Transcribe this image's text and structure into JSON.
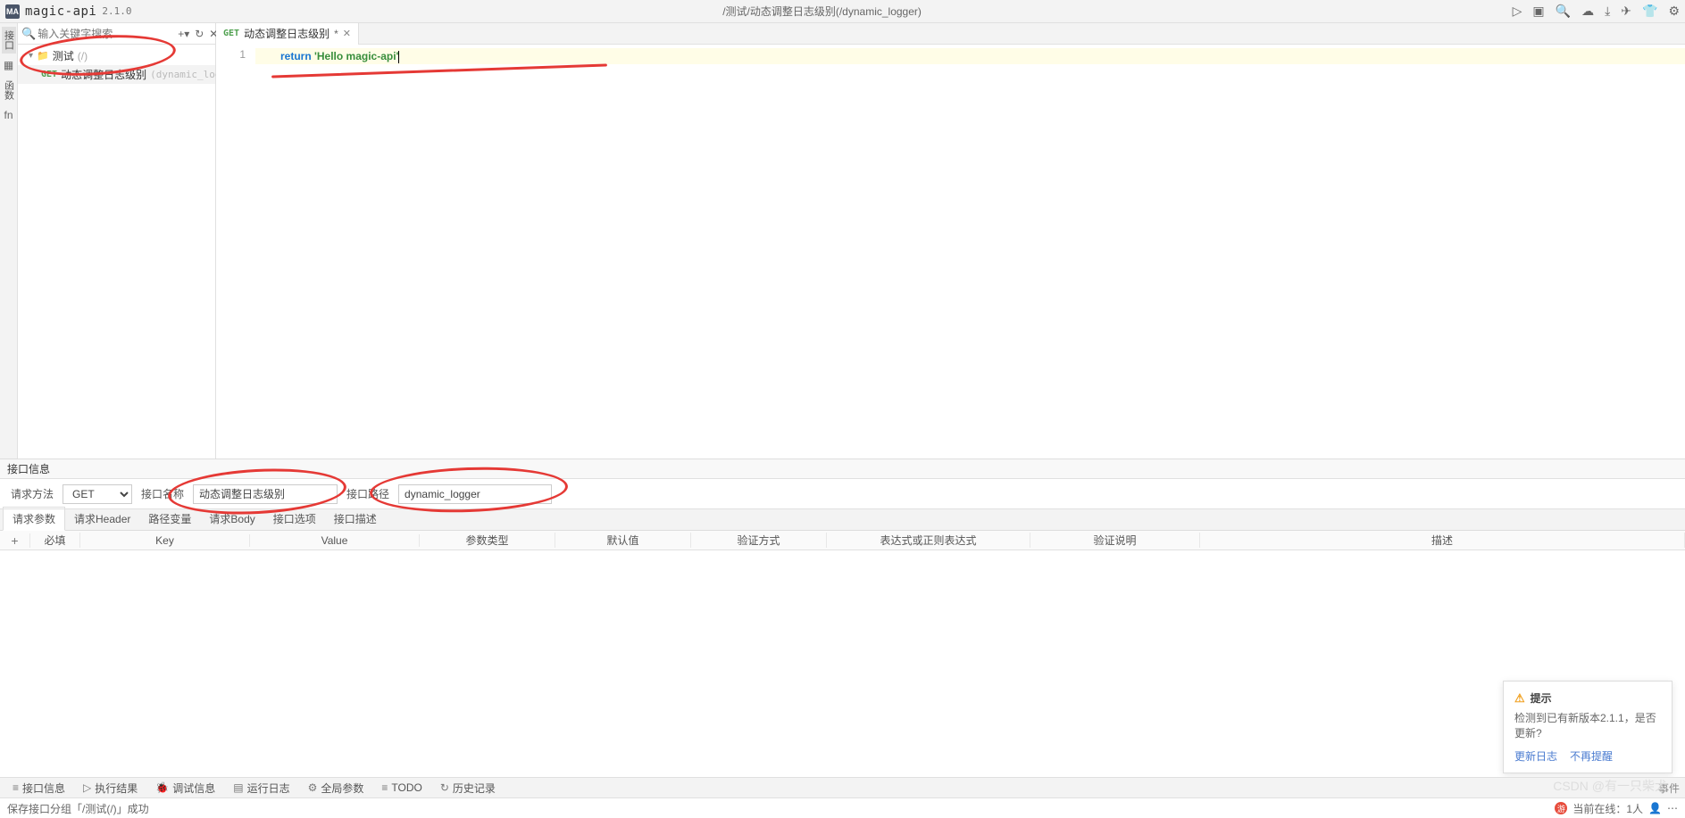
{
  "header": {
    "logo": "MA",
    "app_name": "magic-api",
    "version": "2.1.0",
    "path_display": "/测试/动态调整日志级别(/dynamic_logger)"
  },
  "left_rail": {
    "items": [
      "接口",
      "函数"
    ],
    "icons": [
      "▦",
      "fn"
    ]
  },
  "sidebar": {
    "search_placeholder": "输入关键字搜索",
    "tree": {
      "folder_name": "测试",
      "folder_path": "(/)",
      "child_method": "GET",
      "child_name": "动态调整日志级别",
      "child_path": "(dynamic_logger)"
    }
  },
  "tab": {
    "method": "GET",
    "title": "动态调整日志级别",
    "dirty": "*"
  },
  "code": {
    "line_no": "1",
    "kw": "return",
    "str": "'Hello magic-api'"
  },
  "panel": {
    "title": "接口信息",
    "method_label": "请求方法",
    "method_value": "GET",
    "name_label": "接口名称",
    "name_value": "动态调整日志级别",
    "path_label": "接口路径",
    "path_value": "dynamic_logger"
  },
  "param_tabs": [
    "请求参数",
    "请求Header",
    "路径变量",
    "请求Body",
    "接口选项",
    "接口描述"
  ],
  "param_headers": {
    "required": "必填",
    "key": "Key",
    "value": "Value",
    "ptype": "参数类型",
    "defval": "默认值",
    "vmethod": "验证方式",
    "expr": "表达式或正则表达式",
    "vdesc": "验证说明",
    "desc": "描述"
  },
  "bottom_tabs": {
    "info": "接口信息",
    "result": "执行结果",
    "debug": "调试信息",
    "runlog": "运行日志",
    "global": "全局参数",
    "todo": "TODO",
    "history": "历史记录",
    "events": "事件"
  },
  "notification": {
    "title": "提示",
    "body": "检测到已有新版本2.1.1，是否更新?",
    "link_update": "更新日志",
    "link_dismiss": "不再提醒"
  },
  "status": {
    "left": "保存接口分组「/测试(/)」成功",
    "online_label": "当前在线：1人",
    "online_badge": "游"
  },
  "watermark": "CSDN @有一只柴犬"
}
